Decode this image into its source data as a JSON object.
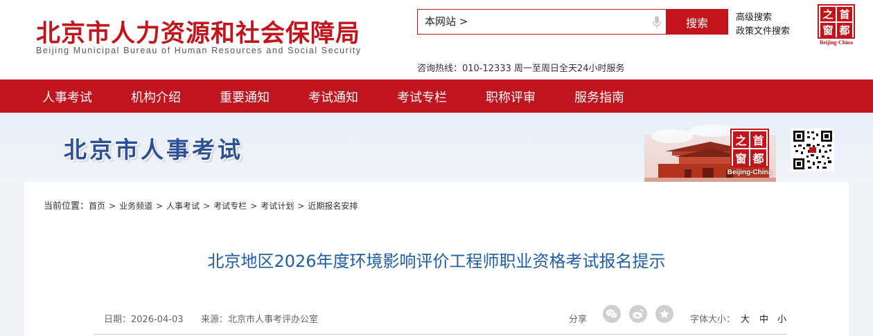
{
  "header": {
    "logo_cn": "北京市人力资源和社会保障局",
    "logo_en": "Beijing Municipal Bureau of Human Resources and Social Security",
    "search_scope": "本网站 >",
    "search_button": "搜索",
    "advanced_search": "高级搜索",
    "policy_search": "政策文件搜索",
    "hotline": "咨询热线：010-12333 周一至周日全天24小时服务",
    "seal_chars": [
      "之",
      "首",
      "窗",
      "都"
    ],
    "seal_label": "Beijing-China"
  },
  "nav": {
    "items": [
      "人事考试",
      "机构介绍",
      "重要通知",
      "考试通知",
      "考试专栏",
      "职称评审",
      "服务指南"
    ]
  },
  "banner": {
    "title": "北京市人事考试",
    "seal_chars": [
      "之",
      "首",
      "窗",
      "都"
    ],
    "seal_label": "Beijing-China"
  },
  "breadcrumb": {
    "label": "当前位置：",
    "items": [
      "首页",
      "业务频道",
      "人事考试",
      "考试专栏",
      "考试计划",
      "近期报名安排"
    ]
  },
  "article": {
    "title": "北京地区2026年度环境影响评价工程师职业资格考试报名提示",
    "date": "日期：2026-04-03",
    "source": "来源：北京市人事考评办公室",
    "share_label": "分享",
    "share_icons": [
      "wechat-icon",
      "weibo-icon",
      "favorite-icon"
    ],
    "font_size_label": "字体大小：",
    "font_sizes": [
      "大",
      "中",
      "小"
    ]
  },
  "colors": {
    "brand_red": "#c3141c",
    "nav_red": "#c0141f",
    "title_blue": "#1d5ea8",
    "banner_title_blue": "#2c4f96"
  }
}
